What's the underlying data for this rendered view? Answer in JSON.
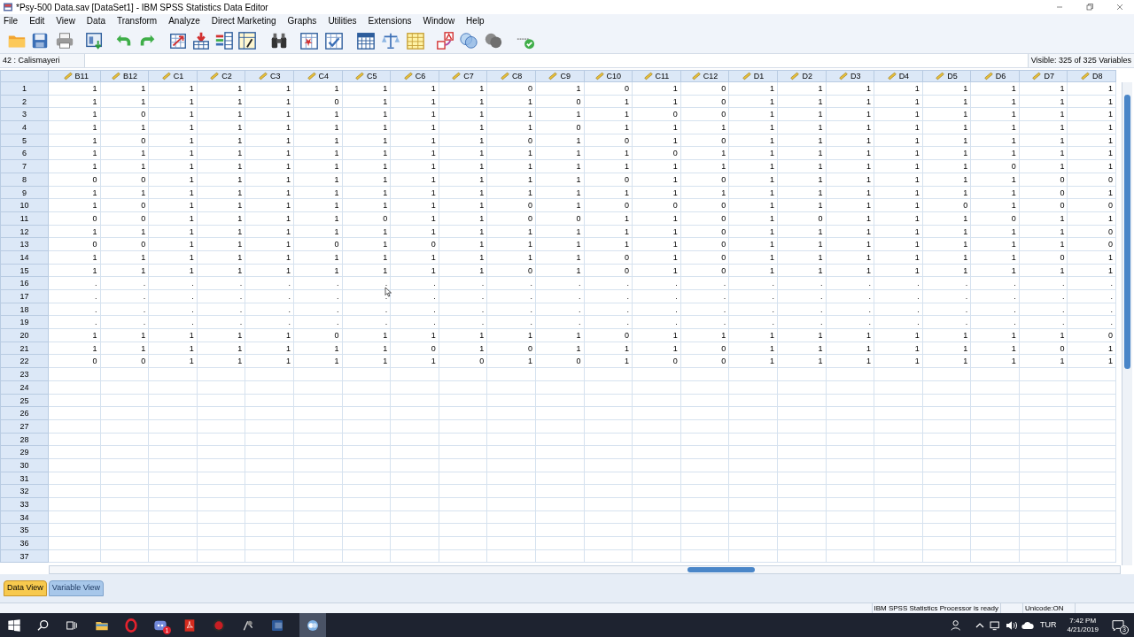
{
  "window": {
    "title": "*Psy-500 Data.sav [DataSet1] - IBM SPSS Statistics Data Editor"
  },
  "menu": [
    "File",
    "Edit",
    "View",
    "Data",
    "Transform",
    "Analyze",
    "Direct Marketing",
    "Graphs",
    "Utilities",
    "Extensions",
    "Window",
    "Help"
  ],
  "cell_editor": {
    "reference": "42 : Calismayeri"
  },
  "variable_count": "Visible: 325 of 325 Variables",
  "table": {
    "columns": [
      "B11",
      "B12",
      "C1",
      "C2",
      "C3",
      "C4",
      "C5",
      "C6",
      "C7",
      "C8",
      "C9",
      "C10",
      "C11",
      "C12",
      "D1",
      "D2",
      "D3",
      "D4",
      "D5",
      "D6",
      "D7",
      "D8"
    ],
    "rows": [
      {
        "number": "1",
        "cells": [
          "1",
          "1",
          "1",
          "1",
          "1",
          "1",
          "1",
          "1",
          "1",
          "0",
          "1",
          "0",
          "1",
          "0",
          "1",
          "1",
          "1",
          "1",
          "1",
          "1",
          "1",
          "1"
        ]
      },
      {
        "number": "2",
        "cells": [
          "1",
          "1",
          "1",
          "1",
          "1",
          "0",
          "1",
          "1",
          "1",
          "1",
          "0",
          "1",
          "1",
          "0",
          "1",
          "1",
          "1",
          "1",
          "1",
          "1",
          "1",
          "1"
        ]
      },
      {
        "number": "3",
        "cells": [
          "1",
          "0",
          "1",
          "1",
          "1",
          "1",
          "1",
          "1",
          "1",
          "1",
          "1",
          "1",
          "0",
          "0",
          "1",
          "1",
          "1",
          "1",
          "1",
          "1",
          "1",
          "1"
        ]
      },
      {
        "number": "4",
        "cells": [
          "1",
          "1",
          "1",
          "1",
          "1",
          "1",
          "1",
          "1",
          "1",
          "1",
          "0",
          "1",
          "1",
          "1",
          "1",
          "1",
          "1",
          "1",
          "1",
          "1",
          "1",
          "1"
        ]
      },
      {
        "number": "5",
        "cells": [
          "1",
          "0",
          "1",
          "1",
          "1",
          "1",
          "1",
          "1",
          "1",
          "0",
          "1",
          "0",
          "1",
          "0",
          "1",
          "1",
          "1",
          "1",
          "1",
          "1",
          "1",
          "1"
        ]
      },
      {
        "number": "6",
        "cells": [
          "1",
          "1",
          "1",
          "1",
          "1",
          "1",
          "1",
          "1",
          "1",
          "1",
          "1",
          "1",
          "0",
          "1",
          "1",
          "1",
          "1",
          "1",
          "1",
          "1",
          "1",
          "1"
        ]
      },
      {
        "number": "7",
        "cells": [
          "1",
          "1",
          "1",
          "1",
          "1",
          "1",
          "1",
          "1",
          "1",
          "1",
          "1",
          "1",
          "1",
          "1",
          "1",
          "1",
          "1",
          "1",
          "1",
          "0",
          "1",
          "1"
        ]
      },
      {
        "number": "8",
        "cells": [
          "0",
          "0",
          "1",
          "1",
          "1",
          "1",
          "1",
          "1",
          "1",
          "1",
          "1",
          "0",
          "1",
          "0",
          "1",
          "1",
          "1",
          "1",
          "1",
          "1",
          "0",
          "0"
        ]
      },
      {
        "number": "9",
        "cells": [
          "1",
          "1",
          "1",
          "1",
          "1",
          "1",
          "1",
          "1",
          "1",
          "1",
          "1",
          "1",
          "1",
          "1",
          "1",
          "1",
          "1",
          "1",
          "1",
          "1",
          "0",
          "1"
        ]
      },
      {
        "number": "10",
        "cells": [
          "1",
          "0",
          "1",
          "1",
          "1",
          "1",
          "1",
          "1",
          "1",
          "0",
          "1",
          "0",
          "0",
          "0",
          "1",
          "1",
          "1",
          "1",
          "0",
          "1",
          "0",
          "0"
        ]
      },
      {
        "number": "11",
        "cells": [
          "0",
          "0",
          "1",
          "1",
          "1",
          "1",
          "0",
          "1",
          "1",
          "0",
          "0",
          "1",
          "1",
          "0",
          "1",
          "0",
          "1",
          "1",
          "1",
          "0",
          "1",
          "1"
        ]
      },
      {
        "number": "12",
        "cells": [
          "1",
          "1",
          "1",
          "1",
          "1",
          "1",
          "1",
          "1",
          "1",
          "1",
          "1",
          "1",
          "1",
          "0",
          "1",
          "1",
          "1",
          "1",
          "1",
          "1",
          "1",
          "0"
        ]
      },
      {
        "number": "13",
        "cells": [
          "0",
          "0",
          "1",
          "1",
          "1",
          "0",
          "1",
          "0",
          "1",
          "1",
          "1",
          "1",
          "1",
          "0",
          "1",
          "1",
          "1",
          "1",
          "1",
          "1",
          "1",
          "0"
        ]
      },
      {
        "number": "14",
        "cells": [
          "1",
          "1",
          "1",
          "1",
          "1",
          "1",
          "1",
          "1",
          "1",
          "1",
          "1",
          "0",
          "1",
          "0",
          "1",
          "1",
          "1",
          "1",
          "1",
          "1",
          "0",
          "1"
        ]
      },
      {
        "number": "15",
        "cells": [
          "1",
          "1",
          "1",
          "1",
          "1",
          "1",
          "1",
          "1",
          "1",
          "0",
          "1",
          "0",
          "1",
          "0",
          "1",
          "1",
          "1",
          "1",
          "1",
          "1",
          "1",
          "1"
        ]
      },
      {
        "number": "16",
        "cells": [
          ".",
          ".",
          ".",
          ".",
          ".",
          ".",
          ".",
          ".",
          ".",
          ".",
          ".",
          ".",
          ".",
          ".",
          ".",
          ".",
          ".",
          ".",
          ".",
          ".",
          ".",
          "."
        ]
      },
      {
        "number": "17",
        "cells": [
          ".",
          ".",
          ".",
          ".",
          ".",
          ".",
          ".",
          ".",
          ".",
          ".",
          ".",
          ".",
          ".",
          ".",
          ".",
          ".",
          ".",
          ".",
          ".",
          ".",
          ".",
          "."
        ]
      },
      {
        "number": "18",
        "cells": [
          ".",
          ".",
          ".",
          ".",
          ".",
          ".",
          ".",
          ".",
          ".",
          ".",
          ".",
          ".",
          ".",
          ".",
          ".",
          ".",
          ".",
          ".",
          ".",
          ".",
          ".",
          "."
        ]
      },
      {
        "number": "19",
        "cells": [
          ".",
          ".",
          ".",
          ".",
          ".",
          ".",
          ".",
          ".",
          ".",
          ".",
          ".",
          ".",
          ".",
          ".",
          ".",
          ".",
          ".",
          ".",
          ".",
          ".",
          ".",
          "."
        ]
      },
      {
        "number": "20",
        "cells": [
          "1",
          "1",
          "1",
          "1",
          "1",
          "0",
          "1",
          "1",
          "1",
          "1",
          "1",
          "0",
          "1",
          "1",
          "1",
          "1",
          "1",
          "1",
          "1",
          "1",
          "1",
          "0"
        ]
      },
      {
        "number": "21",
        "cells": [
          "1",
          "1",
          "1",
          "1",
          "1",
          "1",
          "1",
          "0",
          "1",
          "0",
          "1",
          "1",
          "1",
          "0",
          "1",
          "1",
          "1",
          "1",
          "1",
          "1",
          "0",
          "1"
        ]
      },
      {
        "number": "22",
        "cells": [
          "0",
          "0",
          "1",
          "1",
          "1",
          "1",
          "1",
          "1",
          "0",
          "1",
          "0",
          "1",
          "0",
          "0",
          "1",
          "1",
          "1",
          "1",
          "1",
          "1",
          "1",
          "1"
        ]
      },
      {
        "number": "23"
      },
      {
        "number": "24"
      },
      {
        "number": "25"
      },
      {
        "number": "26"
      },
      {
        "number": "27"
      },
      {
        "number": "28"
      },
      {
        "number": "29"
      },
      {
        "number": "30"
      },
      {
        "number": "31"
      },
      {
        "number": "32"
      },
      {
        "number": "33"
      },
      {
        "number": "34"
      },
      {
        "number": "35"
      },
      {
        "number": "36"
      },
      {
        "number": "37"
      }
    ]
  },
  "tabs": [
    {
      "label": "Data View",
      "selected": true
    },
    {
      "label": "Variable View",
      "selected": false
    }
  ],
  "status_bar": [
    "IBM SPSS Statistics Processor is ready",
    "Unicode:ON"
  ],
  "taskbar": {
    "app_badge": "1",
    "language": "TUR",
    "time": "7:42 PM",
    "date": "4/21/2019",
    "notification_count": "3"
  }
}
